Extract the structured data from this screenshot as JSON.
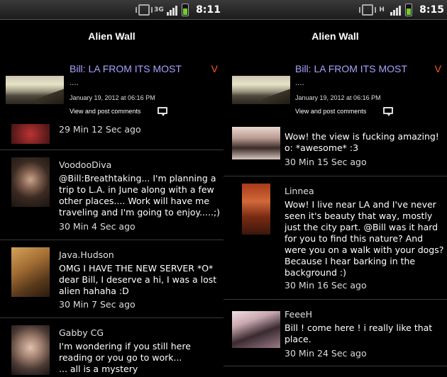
{
  "panels": [
    {
      "status": {
        "network": "3G",
        "time": "8:11"
      },
      "title": "Alien Wall",
      "featured": {
        "title": "Bill: LA FROM ITS MOST",
        "badge": "V",
        "excerpt": "....",
        "date": "January 19, 2012 at 06:16 PM",
        "comments_link": "View and post comments"
      },
      "comments": [
        {
          "author": "",
          "message": "",
          "time": "29 Min 12 Sec ago"
        },
        {
          "author": "VoodooDiva",
          "message": "@Bill:Breathtaking... I'm planning a\ntrip to L.A. in June along with a few\nother places.... Work will have me\ntraveling and I'm going to enjoy.....;)",
          "time": "30 Min 4 Sec ago"
        },
        {
          "author": "Java.Hudson",
          "message": "OMG I HAVE THE NEW SERVER *O*\ndear Bill, I deserve a hi, I was a lost\nalien hahaha :D",
          "time": "30 Min 7 Sec ago"
        },
        {
          "author": "Gabby CG",
          "message": "I'm wondering if you still here\nreading  or you go to work...\n... all is a mystery",
          "time": ""
        }
      ]
    },
    {
      "status": {
        "network": "H",
        "time": "8:15"
      },
      "title": "Alien Wall",
      "featured": {
        "title": "Bill: LA FROM ITS MOST",
        "badge": "V",
        "excerpt": "....",
        "date": "January 19, 2012 at 06:16 PM",
        "comments_link": "View and post comments"
      },
      "comments": [
        {
          "author": "",
          "message": "Wow! the view is fucking amazing!\no: *awesome* :3",
          "time": "30 Min 15 Sec ago"
        },
        {
          "author": "Linnea",
          "message": "Wow! I live near LA and I've never\nseen it's beauty that way, mostly\njust the city part. @Bill was it hard\nfor you to find this nature? And\nwere you on a walk with your dogs?\nBecause I hear barking in the\nbackground :)",
          "time": "30 Min 16 Sec ago"
        },
        {
          "author": "FeeeH",
          "message": "Bill ! come here ! i really like that\nplace.",
          "time": "30 Min 24 Sec ago"
        }
      ]
    }
  ]
}
